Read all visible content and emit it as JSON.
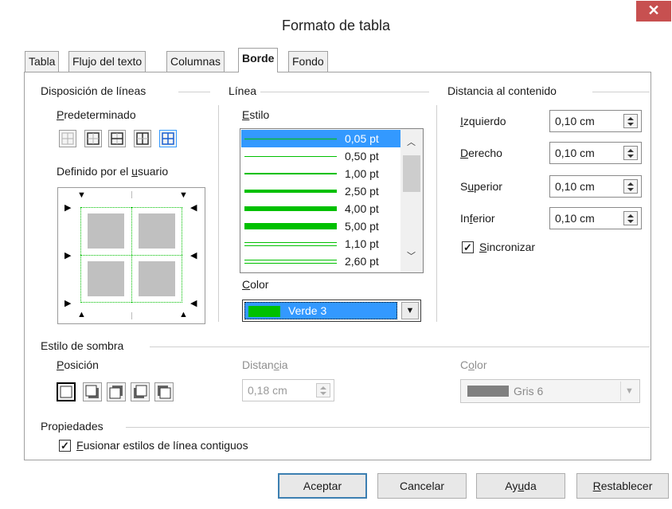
{
  "window": {
    "title": "Formato de tabla",
    "close_glyph": "✕"
  },
  "tabs": [
    {
      "label": "Tabla"
    },
    {
      "label": "Flujo del texto"
    },
    {
      "label": "Columnas"
    },
    {
      "label": "Borde"
    },
    {
      "label": "Fondo"
    }
  ],
  "line_arrangement": {
    "section_title": "Disposición de líneas",
    "default_label": "Predeterminado",
    "user_defined_label": "Definido por el usuario"
  },
  "line": {
    "section_title": "Línea",
    "style_label": "Estilo",
    "styles": [
      {
        "label": "0,05 pt",
        "weight": 1,
        "double": false,
        "selected": true
      },
      {
        "label": "0,50 pt",
        "weight": 1,
        "double": false,
        "selected": false
      },
      {
        "label": "1,00 pt",
        "weight": 2,
        "double": false,
        "selected": false
      },
      {
        "label": "2,50 pt",
        "weight": 4,
        "double": false,
        "selected": false
      },
      {
        "label": "4,00 pt",
        "weight": 6,
        "double": false,
        "selected": false
      },
      {
        "label": "5,00 pt",
        "weight": 8,
        "double": false,
        "selected": false
      },
      {
        "label": "1,10 pt",
        "weight": 1,
        "double": true,
        "selected": false
      },
      {
        "label": "2,60 pt",
        "weight": 1,
        "double": true,
        "selected": false
      }
    ],
    "color_label": "Color",
    "color_value": "Verde 3",
    "color_hex": "#00c000"
  },
  "spacing": {
    "section_title": "Distancia al contenido",
    "left_label": "Izquierdo",
    "left_value": "0,10 cm",
    "right_label": "Derecho",
    "right_value": "0,10 cm",
    "top_label": "Superior",
    "top_value": "0,10 cm",
    "bottom_label": "Inferior",
    "bottom_value": "0,10 cm",
    "sync_label": "Sincronizar",
    "sync_checked": true
  },
  "shadow": {
    "section_title": "Estilo de sombra",
    "position_label": "Posición",
    "distance_label": "Distancia",
    "distance_value": "0,18 cm",
    "color_label": "Color",
    "color_value": "Gris 6",
    "color_hex": "#808080"
  },
  "properties": {
    "section_title": "Propiedades",
    "merge_label": "Fusionar estilos de línea contiguos",
    "merge_checked": true
  },
  "buttons": {
    "ok": "Aceptar",
    "cancel": "Cancelar",
    "help": "Ayuda",
    "reset": "Restablecer"
  },
  "glyphs": {
    "check": "✓",
    "dropdown": "▼"
  }
}
